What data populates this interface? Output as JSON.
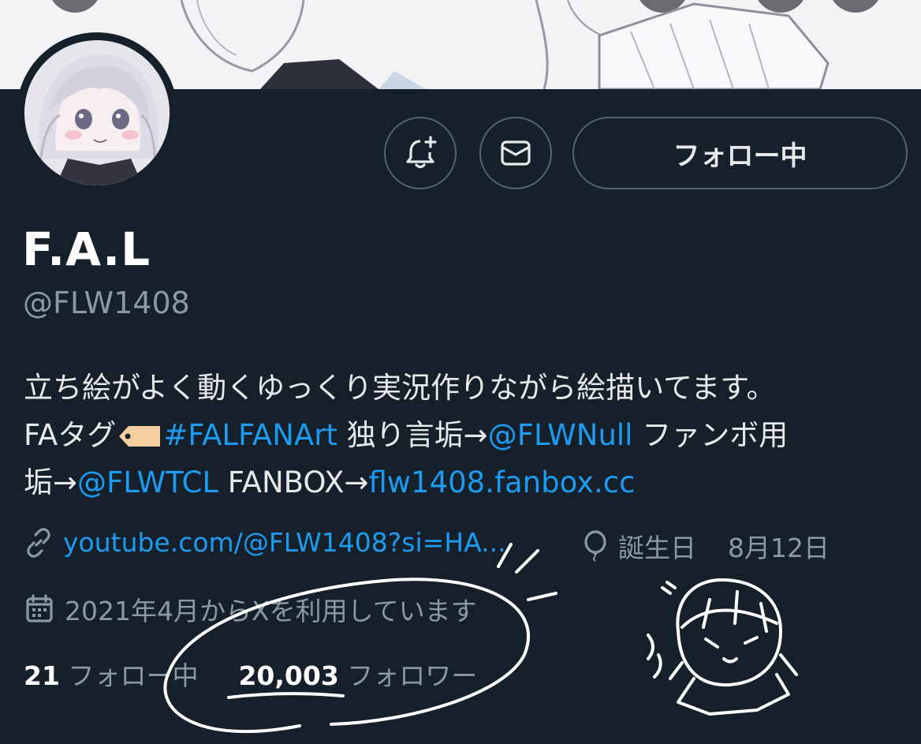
{
  "profile": {
    "display_name": "F.A.L",
    "handle": "@FLW1408",
    "follow_button_label": "フォロー中",
    "bio": {
      "line1": "立ち絵がよく動くゆっくり実況作りながら絵描いてます。",
      "line2_prefix": "FAタグ",
      "hashtag": "#FALFANArt",
      "line2_mid": " 独り言垢→",
      "mention_null": "@FLWNull",
      "line2_suffix": " ファンボ用",
      "line3_prefix": "垢→",
      "mention_tcl": "@FLWTCL",
      "line3_mid": " FANBOX→",
      "fanbox_link": "flw1408.fanbox.cc"
    },
    "website": "youtube.com/@FLW1408?si=HA...",
    "birthday_label": "誕生日",
    "birthday_value": "8月12日",
    "joined": "2021年4月からXを利用しています",
    "following_count": "21",
    "following_label": "フォロー中",
    "followers_count": "20,003",
    "followers_label": "フォロワー"
  },
  "icons": {
    "notify": "bell-plus-icon",
    "message": "envelope-icon",
    "website": "link-icon",
    "birthday": "balloon-icon",
    "joined": "calendar-icon"
  },
  "colors": {
    "background": "#15202b",
    "link": "#1d9bf0",
    "secondary_text": "#8b98a5",
    "border": "#536471"
  }
}
